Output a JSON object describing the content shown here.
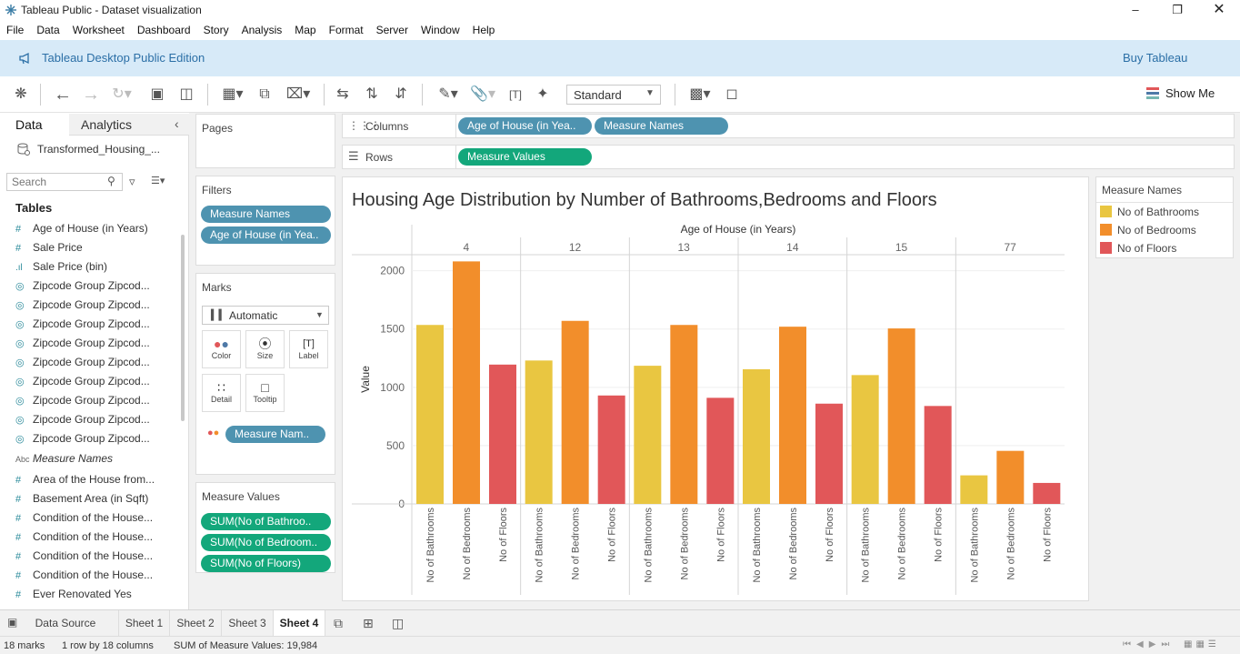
{
  "window": {
    "title": "Tableau Public - Dataset visualization"
  },
  "menu": [
    "File",
    "Data",
    "Worksheet",
    "Dashboard",
    "Story",
    "Analysis",
    "Map",
    "Format",
    "Server",
    "Window",
    "Help"
  ],
  "banner": {
    "edition": "Tableau Desktop Public Edition",
    "buy": "Buy Tableau"
  },
  "toolbar": {
    "fit": "Standard",
    "show_me": "Show Me"
  },
  "left": {
    "tab_data": "Data",
    "tab_analytics": "Analytics",
    "datasource": "Transformed_Housing_...",
    "search_placeholder": "Search",
    "tables_header": "Tables",
    "fields": [
      {
        "icon": "#",
        "label": "Age of House (in Years)"
      },
      {
        "icon": "#",
        "label": "Sale Price"
      },
      {
        "icon": "bin",
        "label": "Sale Price (bin)"
      },
      {
        "icon": "globe",
        "label": "Zipcode Group Zipcod..."
      },
      {
        "icon": "globe",
        "label": "Zipcode Group Zipcod..."
      },
      {
        "icon": "globe",
        "label": "Zipcode Group Zipcod..."
      },
      {
        "icon": "globe",
        "label": "Zipcode Group Zipcod..."
      },
      {
        "icon": "globe",
        "label": "Zipcode Group Zipcod..."
      },
      {
        "icon": "globe",
        "label": "Zipcode Group Zipcod..."
      },
      {
        "icon": "globe",
        "label": "Zipcode Group Zipcod..."
      },
      {
        "icon": "globe",
        "label": "Zipcode Group Zipcod..."
      },
      {
        "icon": "globe",
        "label": "Zipcode Group Zipcod..."
      },
      {
        "icon": "Abc",
        "label": "Measure Names"
      },
      {
        "icon": "#",
        "label": "Area of the House from..."
      },
      {
        "icon": "#",
        "label": "Basement Area (in Sqft)"
      },
      {
        "icon": "#",
        "label": "Condition of the House..."
      },
      {
        "icon": "#",
        "label": "Condition of the House..."
      },
      {
        "icon": "#",
        "label": "Condition of the House..."
      },
      {
        "icon": "#",
        "label": "Condition of the House..."
      },
      {
        "icon": "#",
        "label": "Ever Renovated Yes"
      }
    ]
  },
  "cards": {
    "pages": "Pages",
    "filters": "Filters",
    "filter_pills": [
      "Measure Names",
      "Age of House (in Yea.."
    ],
    "marks": "Marks",
    "mark_type": "Automatic",
    "mark_buttons": [
      "Color",
      "Size",
      "Label",
      "Detail",
      "Tooltip"
    ],
    "marks_pill": "Measure Nam..",
    "measure_values": "Measure Values",
    "mv_pills": [
      "SUM(No of Bathroo..",
      "SUM(No of Bedroom..",
      "SUM(No of Floors)"
    ]
  },
  "shelves": {
    "columns_label": "Columns",
    "columns_pills": [
      "Age of House (in Yea..",
      "Measure Names"
    ],
    "rows_label": "Rows",
    "rows_pills": [
      "Measure Values"
    ]
  },
  "legend": {
    "title": "Measure Names",
    "items": [
      {
        "label": "No of Bathrooms",
        "color": "#e9c641"
      },
      {
        "label": "No of Bedrooms",
        "color": "#f28e2b"
      },
      {
        "label": "No of Floors",
        "color": "#e15759"
      }
    ]
  },
  "chart_data": {
    "type": "bar",
    "title": "Housing Age Distribution by Number of Bathrooms,Bedrooms and Floors",
    "xlabel": "Age of House (in Years)",
    "ylabel": "Value",
    "ylim": [
      0,
      2200
    ],
    "yticks": [
      0,
      500,
      1000,
      1500,
      2000
    ],
    "categories": [
      "4",
      "12",
      "13",
      "14",
      "15",
      "77"
    ],
    "series": [
      {
        "name": "No of Bathrooms",
        "color": "#e9c641",
        "values": [
          1535,
          1230,
          1185,
          1155,
          1105,
          245
        ]
      },
      {
        "name": "No of Bedrooms",
        "color": "#f28e2b",
        "values": [
          2080,
          1570,
          1535,
          1520,
          1505,
          455
        ]
      },
      {
        "name": "No of Floors",
        "color": "#e15759",
        "values": [
          1195,
          930,
          910,
          860,
          840,
          180
        ]
      }
    ]
  },
  "sheets": {
    "data_source": "Data Source",
    "tabs": [
      "Sheet 1",
      "Sheet 2",
      "Sheet 3",
      "Sheet 4"
    ],
    "active": "Sheet 4"
  },
  "status": {
    "marks": "18 marks",
    "rows_cols": "1 row by 18 columns",
    "sum": "SUM of Measure Values: 19,984"
  }
}
